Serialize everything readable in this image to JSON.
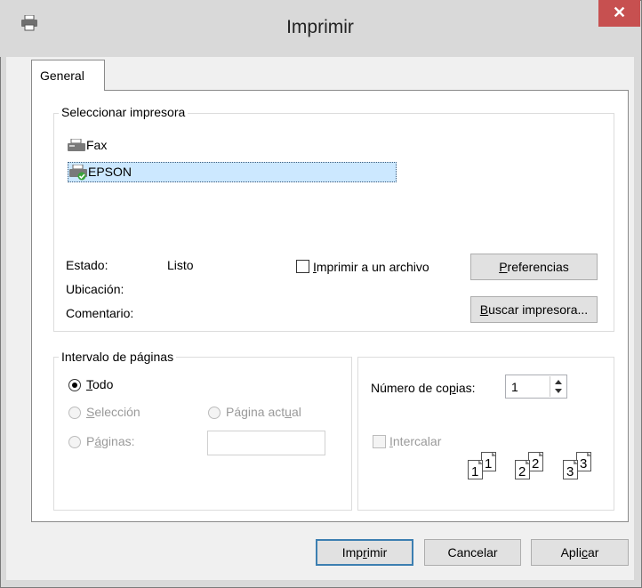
{
  "window": {
    "title": "Imprimir",
    "close_glyph": "✕",
    "printer_icon": "printer-icon"
  },
  "tabs": [
    {
      "label": "General"
    }
  ],
  "select_printer": {
    "legend": "Seleccionar impresora",
    "printers": [
      {
        "name": "Fax",
        "icon": "fax-icon",
        "selected": false
      },
      {
        "name": "EPSON",
        "icon": "printer-default-icon",
        "selected": true
      }
    ],
    "status_label": "Estado:",
    "status_value": "Listo",
    "location_label": "Ubicación:",
    "comment_label": "Comentario:",
    "print_to_file_pre": "",
    "print_to_file_accel": "I",
    "print_to_file_post": "mprimir a un archivo",
    "print_to_file_checked": false,
    "preferences_accel": "P",
    "preferences_post": "referencias",
    "find_printer_accel": "B",
    "find_printer_post": "uscar impresora..."
  },
  "page_range": {
    "legend": "Intervalo de páginas",
    "all_accel": "T",
    "all_post": "odo",
    "selection_accel": "S",
    "selection_post": "elección",
    "current_page_pre": "Página act",
    "current_page_accel": "u",
    "current_page_post": "al",
    "pages_pre": "P",
    "pages_accel": "á",
    "pages_post": "ginas:",
    "pages_value": "",
    "selected": "all"
  },
  "copies": {
    "label_pre": "Número de co",
    "label_accel": "p",
    "label_post": "ias:",
    "value": "1",
    "collate_accel": "I",
    "collate_post": "ntercalar",
    "collate_checked": false,
    "collate_pages": [
      {
        "back": "1",
        "front": "1"
      },
      {
        "back": "2",
        "front": "2"
      },
      {
        "back": "3",
        "front": "3"
      }
    ]
  },
  "footer": {
    "print_pre": "Imp",
    "print_accel": "r",
    "print_post": "imir",
    "cancel": "Cancelar",
    "apply_pre": "Apli",
    "apply_accel": "c",
    "apply_post": "ar"
  },
  "colors": {
    "close_button": "#c75050",
    "selection_highlight": "#cce8ff",
    "default_button_border": "#3c7fb1"
  }
}
